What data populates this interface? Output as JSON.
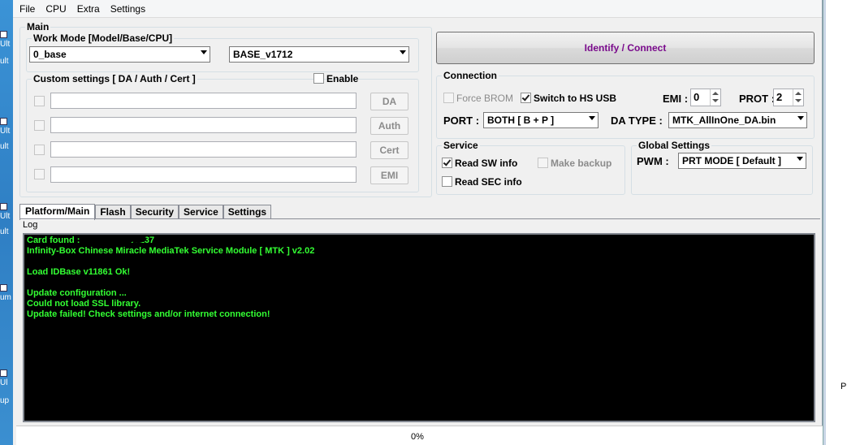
{
  "menu": [
    "File",
    "CPU",
    "Extra",
    "Settings"
  ],
  "main": {
    "title": "Main",
    "work_mode": {
      "title": "Work Mode [Model/Base/CPU]",
      "model": "0_base",
      "base": "BASE_v1712"
    },
    "custom": {
      "title": "Custom settings [ DA / Auth / Cert ]",
      "enable_label": "Enable",
      "buttons": [
        "DA",
        "Auth",
        "Cert",
        "EMI"
      ]
    }
  },
  "identify_button": "Identify / Connect",
  "connection": {
    "title": "Connection",
    "force_brom": "Force BROM",
    "force_brom_checked": false,
    "hs_usb": "Switch to HS USB",
    "hs_usb_checked": true,
    "emi_label": "EMI :",
    "emi_value": "0",
    "prot_label": "PROT :",
    "prot_value": "2",
    "port_label": "PORT :",
    "port_value": "BOTH [ B + P ]",
    "da_type_label": "DA TYPE :",
    "da_type_value": "MTK_AllInOne_DA.bin"
  },
  "service": {
    "title": "Service",
    "read_sw": "Read SW info",
    "read_sw_checked": true,
    "make_backup": "Make backup",
    "make_backup_checked": false,
    "read_sec": "Read SEC info",
    "read_sec_checked": false
  },
  "global": {
    "title": "Global Settings",
    "pwm_label": "PWM :",
    "pwm_value": "PRT MODE [ Default ]"
  },
  "tabs": [
    "Platform/Main",
    "Flash",
    "Security",
    "Service",
    "Settings"
  ],
  "log": {
    "label": "Log",
    "lines": [
      "Card found :                  , v0137",
      "Infinity-Box Chinese Miracle MediaTek Service Module [ MTK ] v2.02",
      "",
      "Load IDBase v11861 Ok!",
      "",
      "Update configuration ...",
      "Could not load SSL library.",
      "Update failed! Check settings and/or internet connection!"
    ],
    "color": "#33ff33"
  },
  "status": {
    "progress": "0%"
  },
  "desktop": {
    "left_labels": [
      "Ult",
      "ult",
      "Ult",
      "ult",
      "Ult",
      "ult",
      "um",
      "Ul",
      "up"
    ],
    "right_text": "Pr"
  }
}
